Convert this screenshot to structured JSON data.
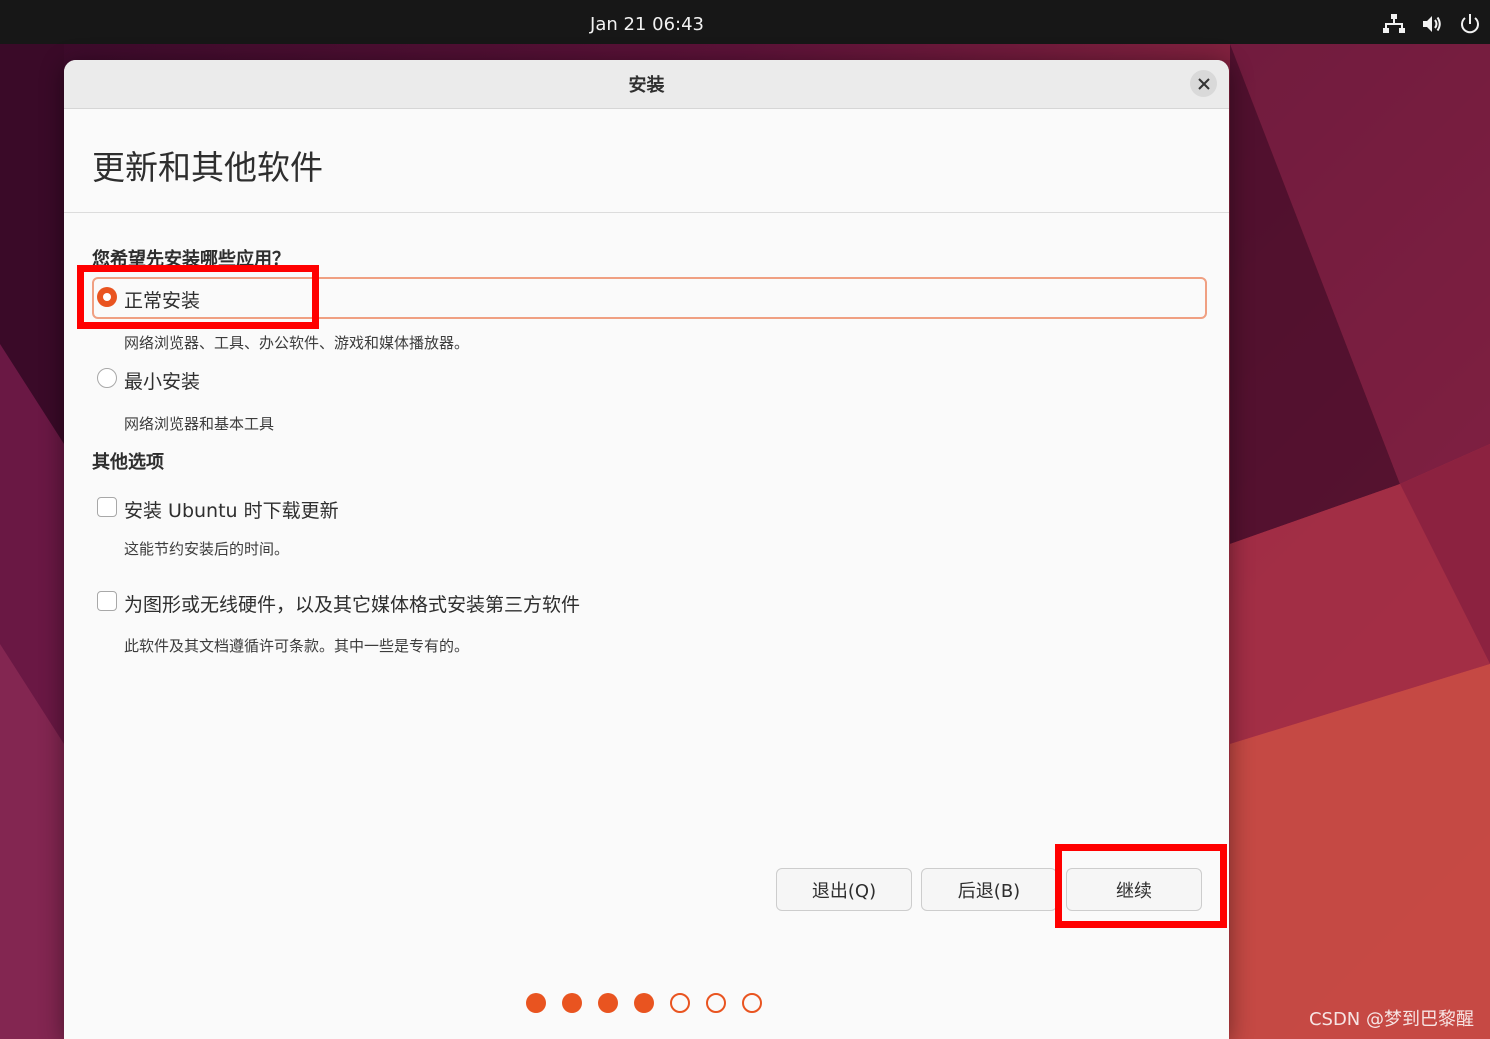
{
  "topbar": {
    "clock": "Jan 21  06:43",
    "icons": [
      "network-icon",
      "volume-icon",
      "power-icon"
    ]
  },
  "window": {
    "title": "安装",
    "page_title": "更新和其他软件",
    "question": "您希望先安装哪些应用？",
    "install_options": [
      {
        "label": "正常安装",
        "description": "网络浏览器、工具、办公软件、游戏和媒体播放器。",
        "selected": true
      },
      {
        "label": "最小安装",
        "description": "网络浏览器和基本工具",
        "selected": false
      }
    ],
    "other_section_title": "其他选项",
    "other_options": [
      {
        "label": "安装 Ubuntu 时下载更新",
        "description": "这能节约安装后的时间。",
        "checked": false
      },
      {
        "label": "为图形或无线硬件，以及其它媒体格式安装第三方软件",
        "description": "此软件及其文档遵循许可条款。其中一些是专有的。",
        "checked": false
      }
    ],
    "buttons": {
      "quit": "退出(Q)",
      "back": "后退(B)",
      "continue": "继续"
    },
    "progress": {
      "total_steps": 7,
      "completed_steps": 4
    }
  },
  "colors": {
    "accent": "#e95420",
    "annotation": "#ff0000"
  },
  "watermark": "CSDN @梦到巴黎醒"
}
